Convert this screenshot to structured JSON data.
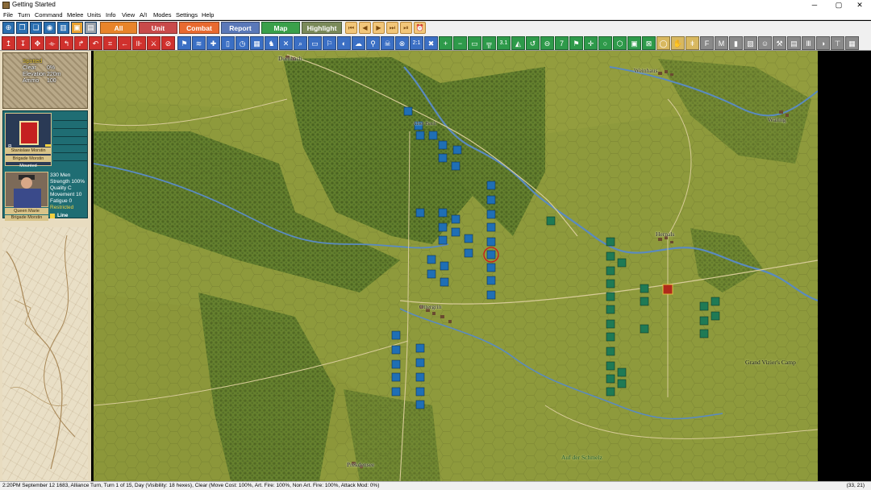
{
  "window": {
    "title": "Getting Started",
    "minimize": "─",
    "maximize": "▢",
    "close": "✕"
  },
  "menu": [
    "File",
    "Turn",
    "Command",
    "Melee",
    "Units",
    "Info",
    "View",
    "A/I",
    "Modes",
    "Settings",
    "Help"
  ],
  "toolbar": {
    "tabs": [
      {
        "label": "All",
        "color": "#e8842a"
      },
      {
        "label": "Unit",
        "color": "#c94a4a"
      },
      {
        "label": "Combat",
        "color": "#e86a30"
      },
      {
        "label": "Report",
        "color": "#5a78b8"
      },
      {
        "label": "Map",
        "color": "#3aa04a"
      },
      {
        "label": "Highlight",
        "color": "#7a8a5a"
      }
    ],
    "zoom_level": "2:1",
    "scale_level": "3.1",
    "turn_digit": "7"
  },
  "info_panel": {
    "terrain": {
      "status": "Spotted",
      "rows": [
        {
          "label": "Clear",
          "value": "0%"
        },
        {
          "label": "Elevation",
          "value": "220m"
        },
        {
          "label": "Ammo",
          "value": "100"
        }
      ]
    },
    "leader": {
      "rank": "B",
      "name": "Stanislaw Morstin",
      "command": "Brigade Morstin",
      "mode": "Mounted"
    },
    "unit": {
      "men": "330 Men",
      "strength": "Strength 100%",
      "quality": "Quality C",
      "movement": "Movement 10",
      "fatigue": "Fatigue 0",
      "status": "Restricted",
      "name": "Queen Marie",
      "brigade": "Brigade Morstin",
      "formation": "Line"
    }
  },
  "map": {
    "places": [
      {
        "name": "Dornbach"
      },
      {
        "name": "Weinhaus"
      },
      {
        "name": "Alser Bach"
      },
      {
        "name": "Wäring"
      },
      {
        "name": "Hernals"
      },
      {
        "name": "Ottergrin"
      },
      {
        "name": "Grand Vizier's Camp"
      },
      {
        "name": "Auf der Schmelz"
      },
      {
        "name": "Prekdensee"
      }
    ],
    "colors": {
      "terrain_clear": "#8e9a3c",
      "terrain_forest": "#4a6a22",
      "river": "#5a8ac0",
      "road": "#d8cc98",
      "polish_unit": "#1f6fb5",
      "imperial_unit": "#1f7a55",
      "hq_unit": "#b02a1a"
    }
  },
  "status_bar": {
    "text": "2:20PM September 12 1683, Alliance Turn, Turn 1 of 15, Day (Visibility: 18 hexes), Clear (Move Cost: 100%, Art. Fire: 100%, Non Art. Fire: 100%, Attack Mod: 0%)",
    "coords": "(33, 21)"
  }
}
